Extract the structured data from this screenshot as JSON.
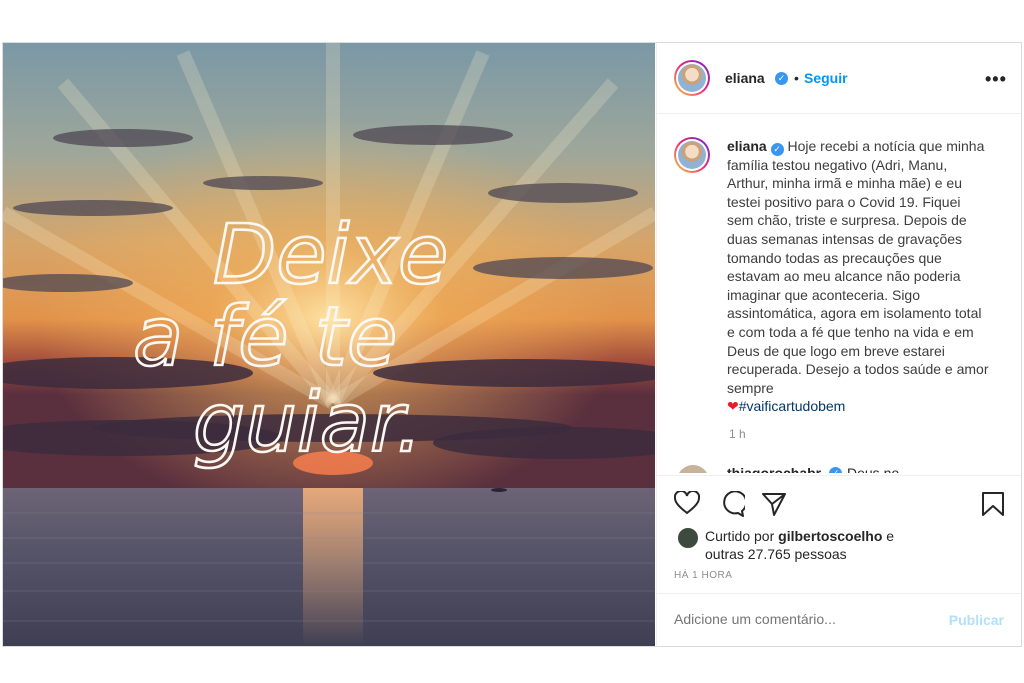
{
  "post": {
    "image_text": {
      "line1": "Deixe",
      "line2": "a fé te",
      "line3": "guiar."
    },
    "header": {
      "username": "eliana",
      "separator": "•",
      "follow_label": "Seguir",
      "more_label": "•••"
    },
    "caption": {
      "username": "eliana",
      "text": "Hoje recebi a notícia que minha família testou negativo (Adri, Manu, Arthur, minha irmã e minha mãe) e eu testei positivo para o Covid 19. Fiquei sem chão, triste e surpresa. Depois de duas semanas intensas de gravações tomando todas as precauções que estavam ao meu alcance não poderia imaginar que aconteceria. Sigo assintomática, agora em isolamento total e com toda a fé que tenho na vida e em Deus de que logo em breve estarei recuperada. Desejo a todos saúde e amor sempre",
      "emoji": "❤",
      "hashtag": "#vaificartudobem",
      "time": "1 h"
    },
    "first_comment": {
      "username": "thiagorochabr",
      "text": "Deus no"
    },
    "likes": {
      "prefix": "Curtido por",
      "user": "gilbertoscoelho",
      "conjunction": "e",
      "others": "outras 27.765 pessoas"
    },
    "posted_ago": "HÁ 1 HORA",
    "comment_box": {
      "placeholder": "Adicione um comentário...",
      "publish_label": "Publicar"
    },
    "icons": [
      "heart-icon",
      "comment-icon",
      "share-icon",
      "bookmark-icon",
      "verified-icon",
      "more-icon"
    ],
    "colors": {
      "accent": "#0095f6",
      "publish_disabled": "#b2dffc",
      "verified": "#3897f0",
      "hashtag": "#00376b"
    }
  }
}
